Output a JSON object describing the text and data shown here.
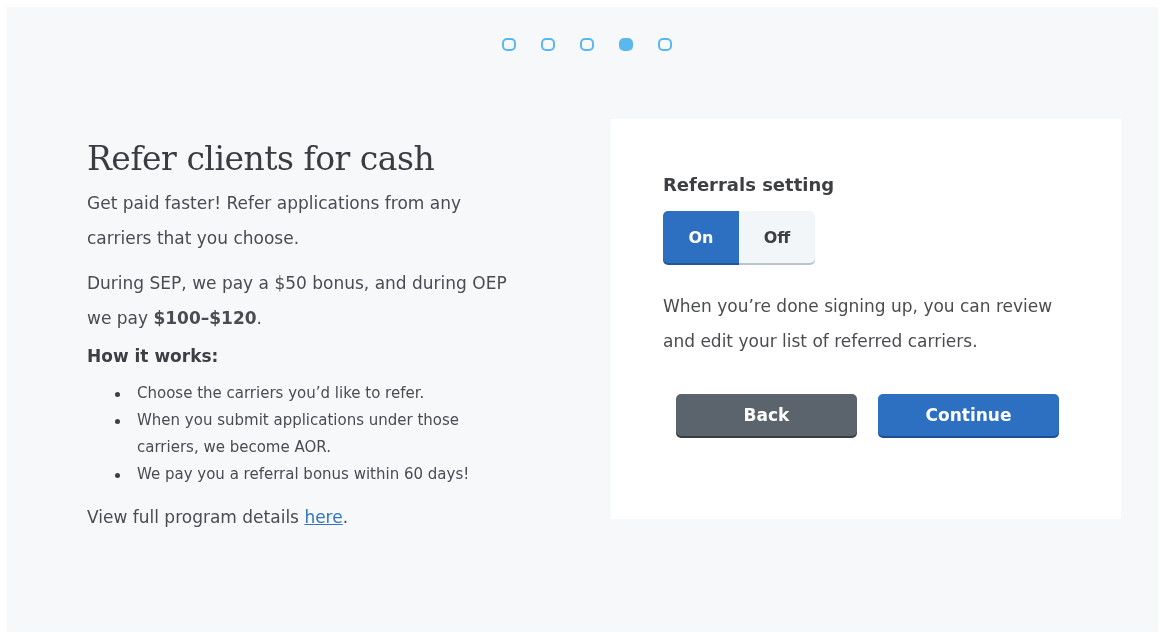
{
  "steps": [
    {
      "selected": false
    },
    {
      "selected": false
    },
    {
      "selected": false
    },
    {
      "selected": true
    },
    {
      "selected": false
    }
  ],
  "intro": {
    "title": "Refer clients for cash",
    "paragraphs": [
      "Get paid faster! Refer applications from any carriers that you choose.",
      "During SEP, we pay a $50 bonus, and during OEP we pay **$100–$120**."
    ],
    "how_heading": "How it works:",
    "bullets": [
      "Choose the carriers you’d like to refer.",
      "When you submit applications under those carriers, we become AOR.",
      "We pay you a referral bonus within 60 days!"
    ],
    "details": {
      "text": "View full program details ",
      "link": "here",
      "suffix": "."
    }
  },
  "card": {
    "heading": "Referrals setting",
    "toggle": [
      {
        "label": "On",
        "selected": true
      },
      {
        "label": "Off",
        "selected": false
      }
    ],
    "note": "When you’re done signing up, you can review and edit your list of referred carriers.",
    "buttons": [
      {
        "label": "Back",
        "kind": "secondary"
      },
      {
        "label": "Continue",
        "kind": "primary"
      }
    ]
  }
}
